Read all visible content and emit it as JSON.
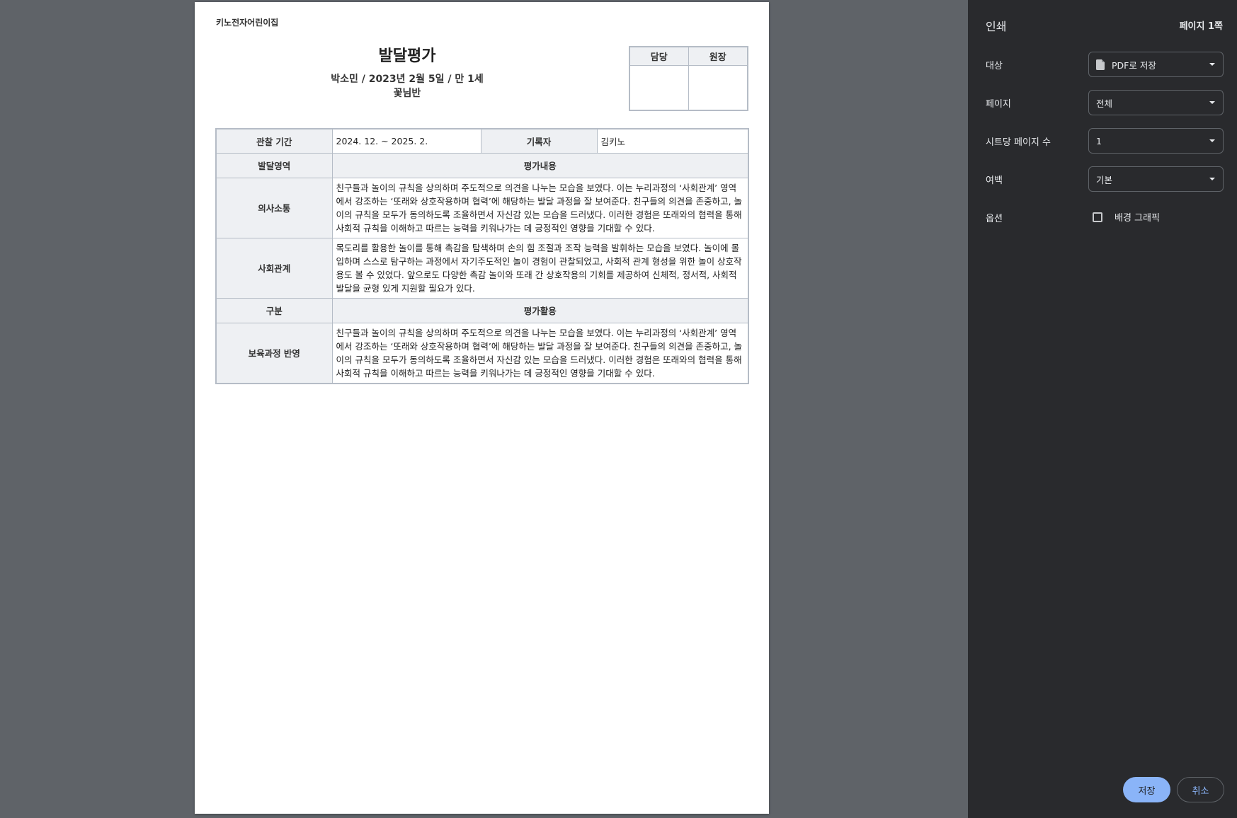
{
  "document": {
    "org_name": "키노전자어린이집",
    "title": "발달평가",
    "subtitle": "박소민 / 2023년 2월 5일 / 만 1세",
    "class_name": "꽃님반",
    "sign": {
      "col1": "담당",
      "col2": "원장"
    },
    "period_label": "관찰 기간",
    "period_value": "2024. 12. ~ 2025. 2.",
    "recorder_label": "기록자",
    "recorder_value": "김키노",
    "area_header": "발달영역",
    "content_header": "평가내용",
    "rows": [
      {
        "area": "의사소통",
        "text": "친구들과 놀이의 규칙을 상의하며 주도적으로 의견을 나누는 모습을 보였다. 이는 누리과정의 ‘사회관계’ 영역에서 강조하는 ‘또래와 상호작용하며 협력’에 해당하는 발달 과정을 잘 보여준다. 친구들의 의견을 존중하고, 놀이의 규칙을 모두가 동의하도록 조율하면서 자신감 있는 모습을 드러냈다. 이러한 경험은 또래와의 협력을 통해 사회적 규칙을 이해하고 따르는 능력을 키워나가는 데 긍정적인 영향을 기대할 수 있다."
      },
      {
        "area": "사회관계",
        "text": "목도리를 활용한 놀이를 통해 촉감을 탐색하며 손의 힘 조절과 조작 능력을 발휘하는 모습을 보였다. 놀이에 몰입하며 스스로 탐구하는 과정에서 자기주도적인 놀이 경험이 관찰되었고, 사회적 관계 형성을 위한 놀이 상호작용도 볼 수 있었다. 앞으로도 다양한 촉감 놀이와 또래 간 상호작용의 기회를 제공하여 신체적, 정서적, 사회적 발달을 균형 있게 지원할 필요가 있다."
      }
    ],
    "category_header": "구분",
    "usage_header": "평가활용",
    "usage_rows": [
      {
        "area": "보육과정 반영",
        "text": "친구들과 놀이의 규칙을 상의하며 주도적으로 의견을 나누는 모습을 보였다. 이는 누리과정의 ‘사회관계’ 영역에서 강조하는 ‘또래와 상호작용하며 협력’에 해당하는 발달 과정을 잘 보여준다. 친구들의 의견을 존중하고, 놀이의 규칙을 모두가 동의하도록 조율하면서 자신감 있는 모습을 드러냈다. 이러한 경험은 또래와의 협력을 통해 사회적 규칙을 이해하고 따르는 능력을 키워나가는 데 긍정적인 영향을 기대할 수 있다."
      }
    ]
  },
  "print_panel": {
    "title": "인쇄",
    "page_count": "페이지 1쪽",
    "destination_label": "대상",
    "destination_value": "PDF로 저장",
    "destination_icon": "document-icon",
    "pages_label": "페이지",
    "pages_value": "전체",
    "pages_per_sheet_label": "시트당 페이지 수",
    "pages_per_sheet_value": "1",
    "margins_label": "여백",
    "margins_value": "기본",
    "options_label": "옵션",
    "background_graphics_label": "배경 그래픽",
    "background_graphics_checked": false,
    "save_button": "저장",
    "cancel_button": "취소",
    "colors": {
      "panel_bg": "#292a2d",
      "preview_bg": "#5f6368",
      "accent": "#8ab4f8"
    }
  }
}
